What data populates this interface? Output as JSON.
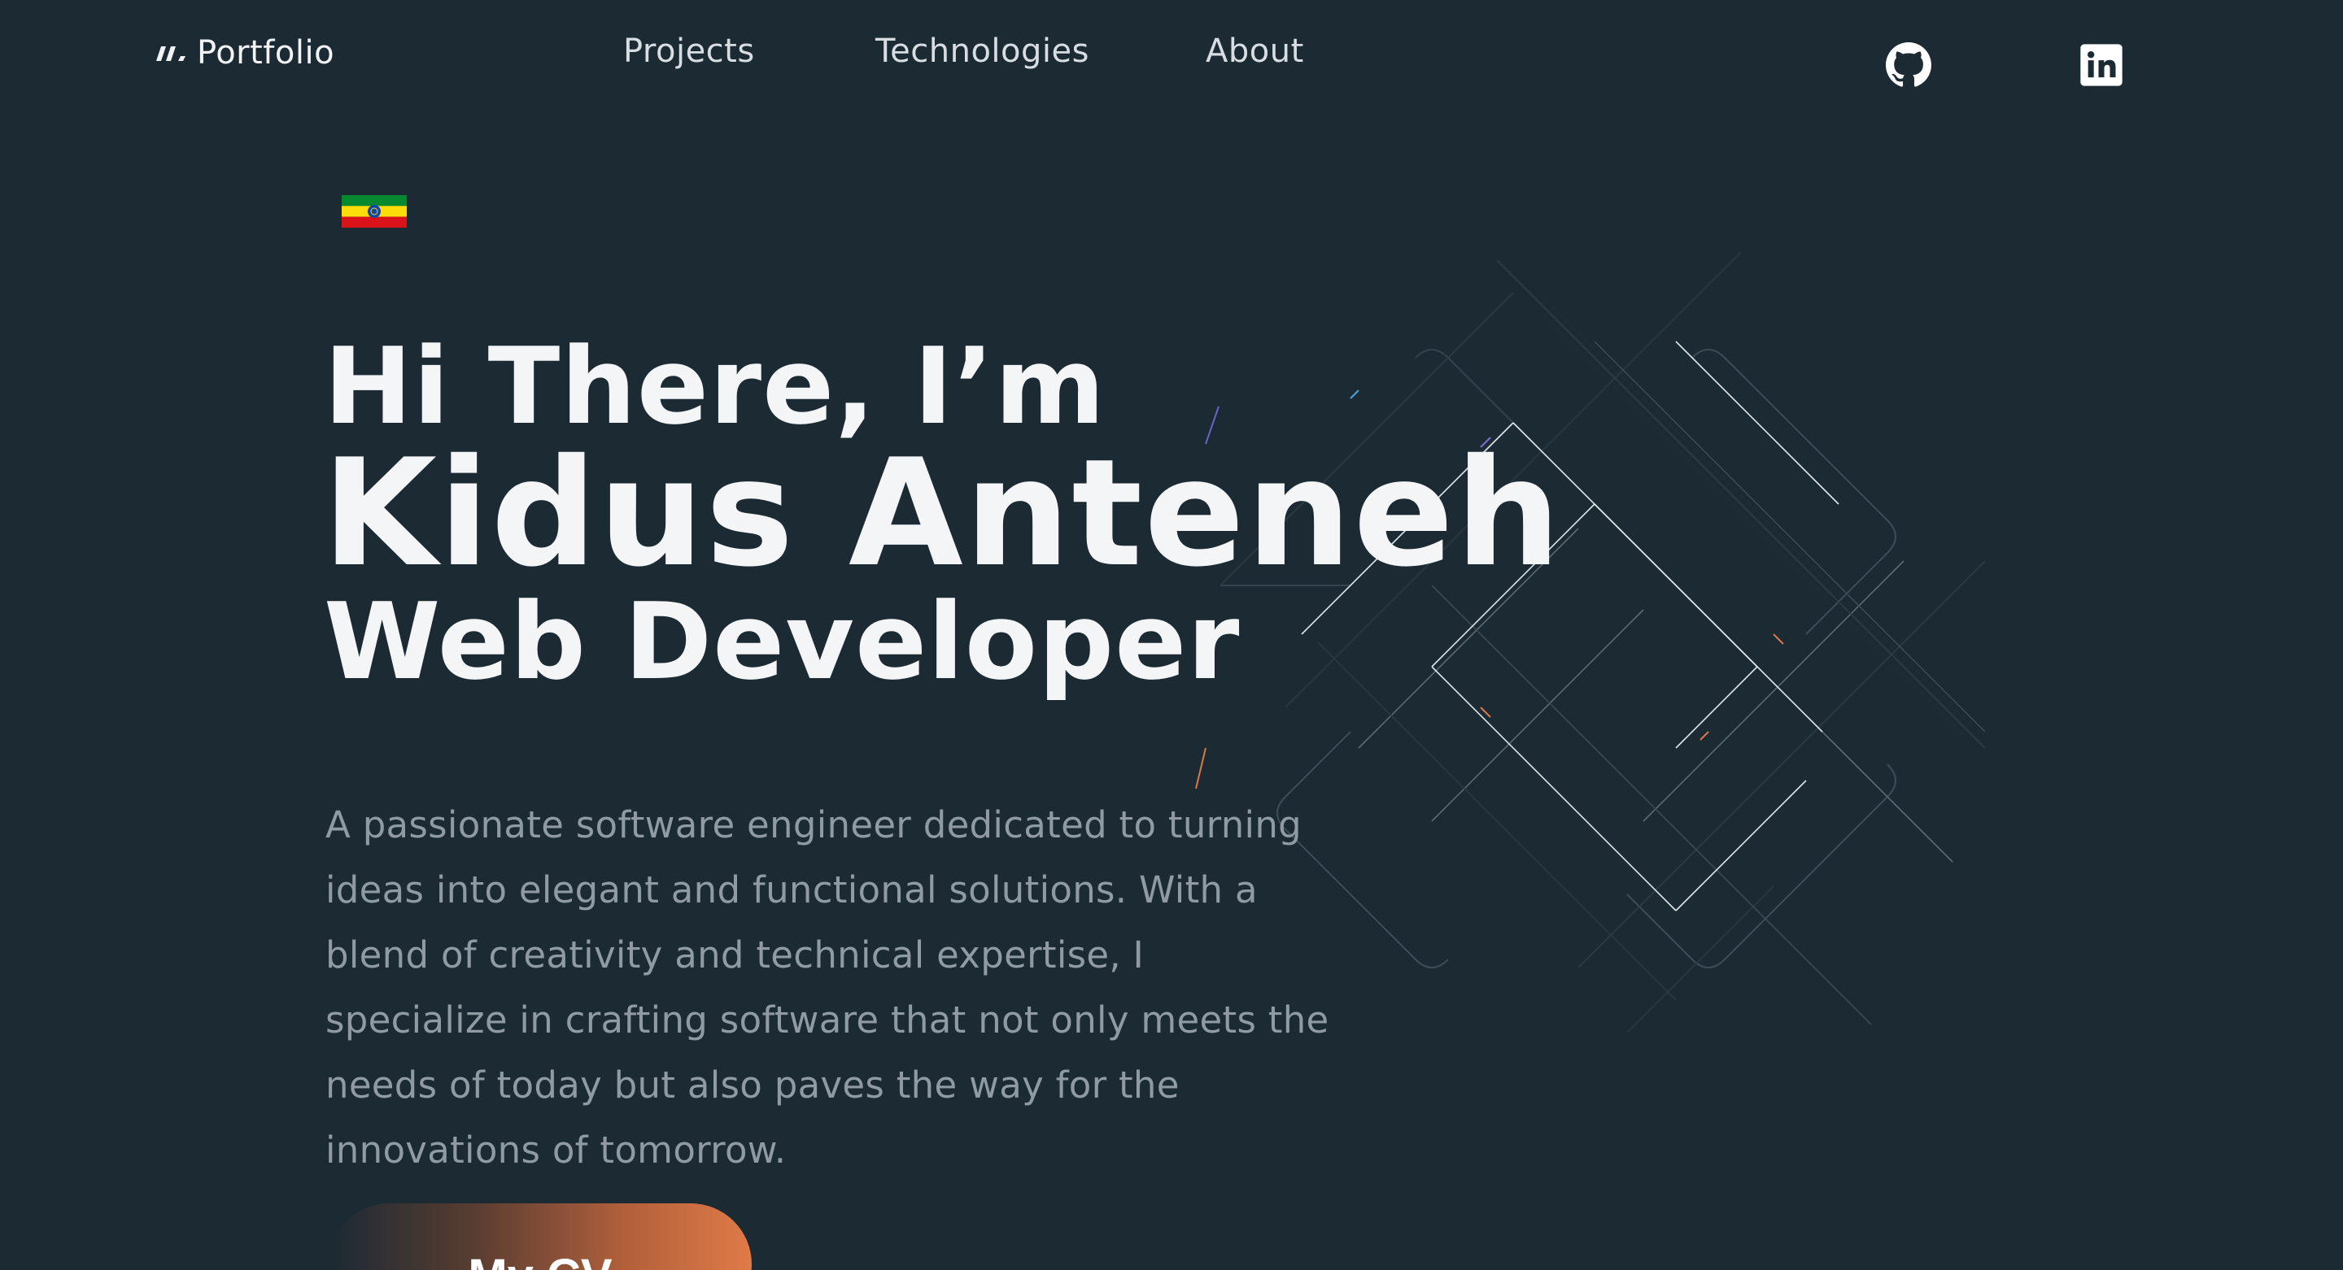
{
  "nav": {
    "logo_text": "Portfolio",
    "links": [
      {
        "label": "Projects"
      },
      {
        "label": "Technologies"
      },
      {
        "label": "About"
      }
    ],
    "social": [
      {
        "icon": "github-icon"
      },
      {
        "icon": "linkedin-icon"
      }
    ]
  },
  "hero": {
    "flag_icon": "ethiopia-flag-icon",
    "greeting": "Hi There, I’m",
    "name": "Kidus Anteneh",
    "role": "Web Developer",
    "description": "A passionate software engineer dedicated to turning ideas into elegant and functional solutions. With a blend of creativity and technical expertise, I specialize in crafting software that not only meets the needs of today but also paves the way for the innovations of tomorrow.",
    "cv_button": "My CV"
  },
  "colors": {
    "background": "#1b2a33",
    "text_primary": "#f3f5f7",
    "text_muted": "#8f9aa3",
    "accent": "#e07a47"
  }
}
